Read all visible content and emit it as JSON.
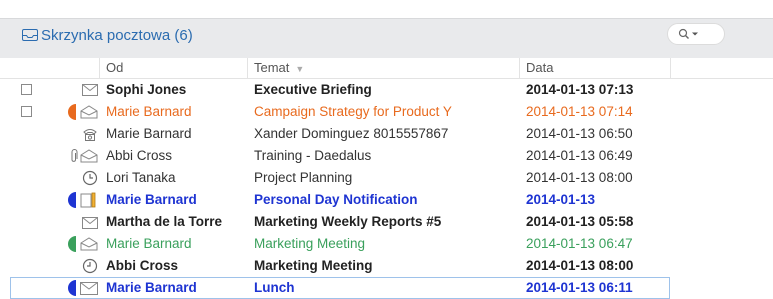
{
  "folder": {
    "title": "Skrzynka pocztowa (6)"
  },
  "columns": {
    "from": "Od",
    "subject": "Temat",
    "date": "Data"
  },
  "rows": [
    {
      "from": "Sophi Jones",
      "subject": "Executive Briefing",
      "date": "2014-01-13 07:13"
    },
    {
      "from": "Marie Barnard",
      "subject": "Campaign Strategy for Product Y",
      "date": "2014-01-13 07:14"
    },
    {
      "from": "Marie Barnard",
      "subject": "Xander Dominguez 8015557867",
      "date": "2014-01-13 06:50"
    },
    {
      "from": "Abbi Cross",
      "subject": "Training - Daedalus",
      "date": "2014-01-13 06:49"
    },
    {
      "from": "Lori Tanaka",
      "subject": "Project Planning",
      "date": "2014-01-13 08:00"
    },
    {
      "from": "Marie Barnard",
      "subject": "Personal Day Notification",
      "date": "2014-01-13"
    },
    {
      "from": "Martha de la Torre",
      "subject": "Marketing Weekly Reports #5",
      "date": "2014-01-13 05:58"
    },
    {
      "from": "Marie Barnard",
      "subject": "Marketing Meeting",
      "date": "2014-01-13 06:47"
    },
    {
      "from": "Abbi Cross",
      "subject": "Marketing Meeting",
      "date": "2014-01-13 08:00"
    },
    {
      "from": "Marie Barnard",
      "subject": "Lunch",
      "date": "2014-01-13 06:11"
    }
  ],
  "colors": {
    "orange": "#e86a1e",
    "blue": "#1e34d2",
    "green": "#3aa05c",
    "accent": "#2b6cb0"
  },
  "icons": {
    "mailbox": "mailbox-icon",
    "search": "search-icon",
    "envelope": "envelope-icon",
    "phone": "phone-icon",
    "attachment": "paperclip-icon",
    "clock": "clock-icon",
    "category": "category-color-icon",
    "sort": "sort-descending-icon"
  }
}
